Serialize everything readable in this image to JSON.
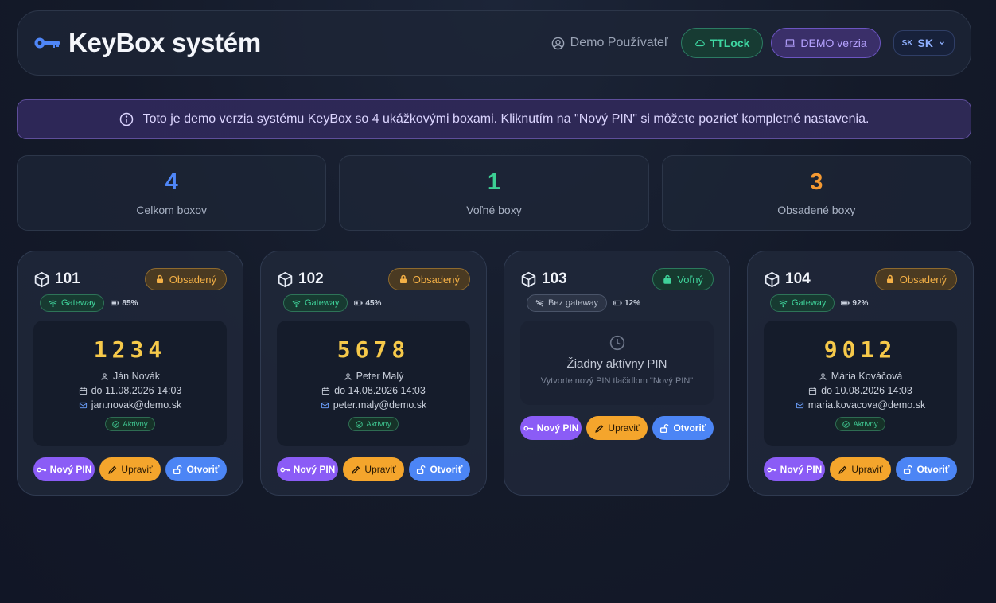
{
  "header": {
    "title": "KeyBox systém",
    "user": "Demo Používateľ",
    "ttlock_label": "TTLock",
    "demo_label": "DEMO verzia",
    "lang_flag": "SK",
    "lang_label": "SK"
  },
  "info_banner": "Toto je demo verzia systému KeyBox so 4 ukážkovými boxami. Kliknutím na \"Nový PIN\" si môžete pozrieť kompletné nastavenia.",
  "stats": [
    {
      "value": "4",
      "label": "Celkom boxov",
      "color": "#4f86f7"
    },
    {
      "value": "1",
      "label": "Voľné boxy",
      "color": "#3ccf94"
    },
    {
      "value": "3",
      "label": "Obsadené boxy",
      "color": "#f59a32"
    }
  ],
  "actions": {
    "new_pin": "Nový PIN",
    "edit": "Upraviť",
    "open": "Otvoriť"
  },
  "boxes": [
    {
      "id": "101",
      "status": "Obsadený",
      "gateway": "Gateway",
      "battery": "85%",
      "pin": "1234",
      "name": "Ján Novák",
      "until": "do 11.08.2026 14:03",
      "email": "jan.novak@demo.sk",
      "active": "Aktívny"
    },
    {
      "id": "102",
      "status": "Obsadený",
      "gateway": "Gateway",
      "battery": "45%",
      "pin": "5678",
      "name": "Peter Malý",
      "until": "do 14.08.2026 14:03",
      "email": "peter.maly@demo.sk",
      "active": "Aktívny"
    },
    {
      "id": "103",
      "status": "Voľný",
      "gateway": "Bez gateway",
      "battery": "12%",
      "empty_title": "Žiadny aktívny PIN",
      "empty_sub": "Vytvorte nový PIN tlačidlom \"Nový PIN\""
    },
    {
      "id": "104",
      "status": "Obsadený",
      "gateway": "Gateway",
      "battery": "92%",
      "pin": "9012",
      "name": "Mária Kováčová",
      "until": "do 10.08.2026 14:03",
      "email": "maria.kovacova@demo.sk",
      "active": "Aktívny"
    }
  ]
}
